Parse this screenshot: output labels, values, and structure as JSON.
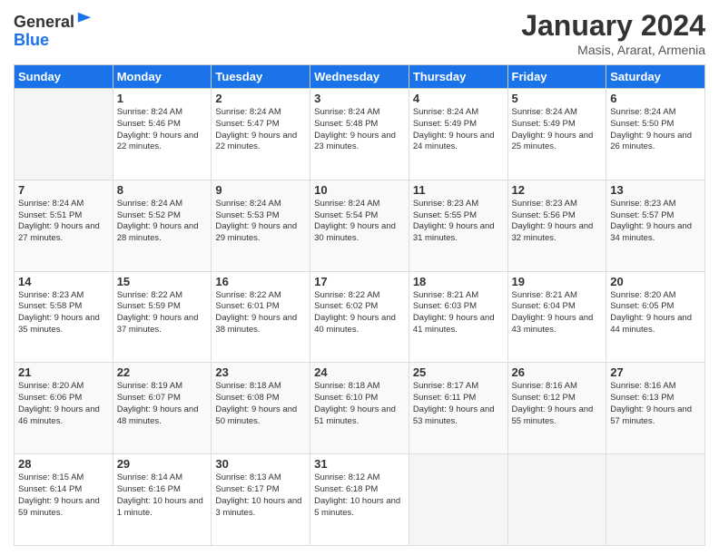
{
  "header": {
    "logo_general": "General",
    "logo_blue": "Blue",
    "month_title": "January 2024",
    "location": "Masis, Ararat, Armenia"
  },
  "weekdays": [
    "Sunday",
    "Monday",
    "Tuesday",
    "Wednesday",
    "Thursday",
    "Friday",
    "Saturday"
  ],
  "weeks": [
    [
      {
        "day": "",
        "sunrise": "",
        "sunset": "",
        "daylight": ""
      },
      {
        "day": "1",
        "sunrise": "Sunrise: 8:24 AM",
        "sunset": "Sunset: 5:46 PM",
        "daylight": "Daylight: 9 hours and 22 minutes."
      },
      {
        "day": "2",
        "sunrise": "Sunrise: 8:24 AM",
        "sunset": "Sunset: 5:47 PM",
        "daylight": "Daylight: 9 hours and 22 minutes."
      },
      {
        "day": "3",
        "sunrise": "Sunrise: 8:24 AM",
        "sunset": "Sunset: 5:48 PM",
        "daylight": "Daylight: 9 hours and 23 minutes."
      },
      {
        "day": "4",
        "sunrise": "Sunrise: 8:24 AM",
        "sunset": "Sunset: 5:49 PM",
        "daylight": "Daylight: 9 hours and 24 minutes."
      },
      {
        "day": "5",
        "sunrise": "Sunrise: 8:24 AM",
        "sunset": "Sunset: 5:49 PM",
        "daylight": "Daylight: 9 hours and 25 minutes."
      },
      {
        "day": "6",
        "sunrise": "Sunrise: 8:24 AM",
        "sunset": "Sunset: 5:50 PM",
        "daylight": "Daylight: 9 hours and 26 minutes."
      }
    ],
    [
      {
        "day": "7",
        "sunrise": "Sunrise: 8:24 AM",
        "sunset": "Sunset: 5:51 PM",
        "daylight": "Daylight: 9 hours and 27 minutes."
      },
      {
        "day": "8",
        "sunrise": "Sunrise: 8:24 AM",
        "sunset": "Sunset: 5:52 PM",
        "daylight": "Daylight: 9 hours and 28 minutes."
      },
      {
        "day": "9",
        "sunrise": "Sunrise: 8:24 AM",
        "sunset": "Sunset: 5:53 PM",
        "daylight": "Daylight: 9 hours and 29 minutes."
      },
      {
        "day": "10",
        "sunrise": "Sunrise: 8:24 AM",
        "sunset": "Sunset: 5:54 PM",
        "daylight": "Daylight: 9 hours and 30 minutes."
      },
      {
        "day": "11",
        "sunrise": "Sunrise: 8:23 AM",
        "sunset": "Sunset: 5:55 PM",
        "daylight": "Daylight: 9 hours and 31 minutes."
      },
      {
        "day": "12",
        "sunrise": "Sunrise: 8:23 AM",
        "sunset": "Sunset: 5:56 PM",
        "daylight": "Daylight: 9 hours and 32 minutes."
      },
      {
        "day": "13",
        "sunrise": "Sunrise: 8:23 AM",
        "sunset": "Sunset: 5:57 PM",
        "daylight": "Daylight: 9 hours and 34 minutes."
      }
    ],
    [
      {
        "day": "14",
        "sunrise": "Sunrise: 8:23 AM",
        "sunset": "Sunset: 5:58 PM",
        "daylight": "Daylight: 9 hours and 35 minutes."
      },
      {
        "day": "15",
        "sunrise": "Sunrise: 8:22 AM",
        "sunset": "Sunset: 5:59 PM",
        "daylight": "Daylight: 9 hours and 37 minutes."
      },
      {
        "day": "16",
        "sunrise": "Sunrise: 8:22 AM",
        "sunset": "Sunset: 6:01 PM",
        "daylight": "Daylight: 9 hours and 38 minutes."
      },
      {
        "day": "17",
        "sunrise": "Sunrise: 8:22 AM",
        "sunset": "Sunset: 6:02 PM",
        "daylight": "Daylight: 9 hours and 40 minutes."
      },
      {
        "day": "18",
        "sunrise": "Sunrise: 8:21 AM",
        "sunset": "Sunset: 6:03 PM",
        "daylight": "Daylight: 9 hours and 41 minutes."
      },
      {
        "day": "19",
        "sunrise": "Sunrise: 8:21 AM",
        "sunset": "Sunset: 6:04 PM",
        "daylight": "Daylight: 9 hours and 43 minutes."
      },
      {
        "day": "20",
        "sunrise": "Sunrise: 8:20 AM",
        "sunset": "Sunset: 6:05 PM",
        "daylight": "Daylight: 9 hours and 44 minutes."
      }
    ],
    [
      {
        "day": "21",
        "sunrise": "Sunrise: 8:20 AM",
        "sunset": "Sunset: 6:06 PM",
        "daylight": "Daylight: 9 hours and 46 minutes."
      },
      {
        "day": "22",
        "sunrise": "Sunrise: 8:19 AM",
        "sunset": "Sunset: 6:07 PM",
        "daylight": "Daylight: 9 hours and 48 minutes."
      },
      {
        "day": "23",
        "sunrise": "Sunrise: 8:18 AM",
        "sunset": "Sunset: 6:08 PM",
        "daylight": "Daylight: 9 hours and 50 minutes."
      },
      {
        "day": "24",
        "sunrise": "Sunrise: 8:18 AM",
        "sunset": "Sunset: 6:10 PM",
        "daylight": "Daylight: 9 hours and 51 minutes."
      },
      {
        "day": "25",
        "sunrise": "Sunrise: 8:17 AM",
        "sunset": "Sunset: 6:11 PM",
        "daylight": "Daylight: 9 hours and 53 minutes."
      },
      {
        "day": "26",
        "sunrise": "Sunrise: 8:16 AM",
        "sunset": "Sunset: 6:12 PM",
        "daylight": "Daylight: 9 hours and 55 minutes."
      },
      {
        "day": "27",
        "sunrise": "Sunrise: 8:16 AM",
        "sunset": "Sunset: 6:13 PM",
        "daylight": "Daylight: 9 hours and 57 minutes."
      }
    ],
    [
      {
        "day": "28",
        "sunrise": "Sunrise: 8:15 AM",
        "sunset": "Sunset: 6:14 PM",
        "daylight": "Daylight: 9 hours and 59 minutes."
      },
      {
        "day": "29",
        "sunrise": "Sunrise: 8:14 AM",
        "sunset": "Sunset: 6:16 PM",
        "daylight": "Daylight: 10 hours and 1 minute."
      },
      {
        "day": "30",
        "sunrise": "Sunrise: 8:13 AM",
        "sunset": "Sunset: 6:17 PM",
        "daylight": "Daylight: 10 hours and 3 minutes."
      },
      {
        "day": "31",
        "sunrise": "Sunrise: 8:12 AM",
        "sunset": "Sunset: 6:18 PM",
        "daylight": "Daylight: 10 hours and 5 minutes."
      },
      {
        "day": "",
        "sunrise": "",
        "sunset": "",
        "daylight": ""
      },
      {
        "day": "",
        "sunrise": "",
        "sunset": "",
        "daylight": ""
      },
      {
        "day": "",
        "sunrise": "",
        "sunset": "",
        "daylight": ""
      }
    ]
  ]
}
